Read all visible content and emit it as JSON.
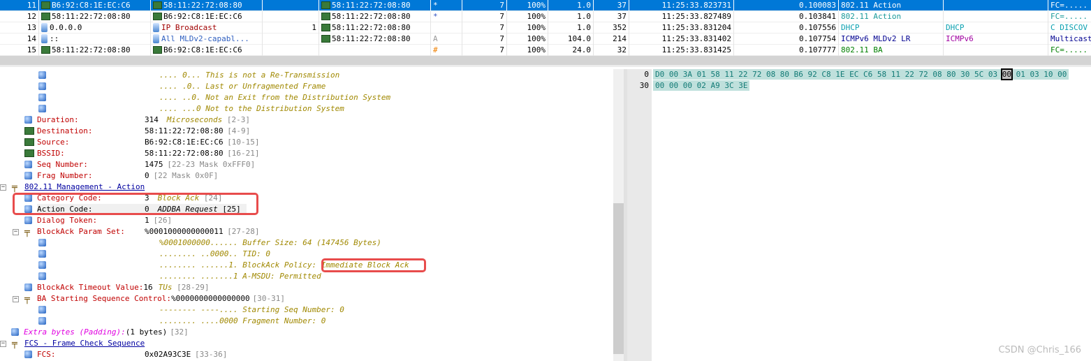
{
  "packets": [
    {
      "no": "11",
      "src": "B6:92:C8:1E:EC:C6",
      "src_icon": "mac",
      "dst": "58:11:22:72:08:80",
      "dst_icon": "mac",
      "col4": "",
      "bssid": "58:11:22:72:08:80",
      "flag": "*",
      "ch": "7",
      "sig": "100%",
      "rate": "1.0",
      "size": "37",
      "time": "11:25:33.823731",
      "delta": "0.100083",
      "proto": "802.11 Action",
      "proto2": "",
      "summary": "FC=.....",
      "color": "#ffffff",
      "selected": true
    },
    {
      "no": "12",
      "src": "58:11:22:72:08:80",
      "src_icon": "mac",
      "dst": "B6:92:C8:1E:EC:C6",
      "dst_icon": "mac",
      "col4": "",
      "bssid": "58:11:22:72:08:80",
      "flag": "*",
      "ch": "7",
      "sig": "100%",
      "rate": "1.0",
      "size": "37",
      "time": "11:25:33.827489",
      "delta": "0.103841",
      "proto": "802.11 Action",
      "proto2": "",
      "summary": "FC=.....",
      "color": "#1a9a9a"
    },
    {
      "no": "13",
      "src": "0.0.0.0",
      "src_icon": "pc",
      "dst": "IP Broadcast",
      "dst_icon": "pc",
      "dst_color": "#a00000",
      "col4": "1",
      "bssid": "58:11:22:72:08:80",
      "flag": "",
      "ch": "7",
      "sig": "100%",
      "rate": "1.0",
      "size": "352",
      "time": "11:25:33.831204",
      "delta": "0.107556",
      "proto": "DHCP",
      "proto2": "DHCP",
      "summary": "C DISCOV",
      "color": "#0aa0b0"
    },
    {
      "no": "14",
      "src": "::",
      "src_icon": "pc",
      "dst": "All MLDv2-capabl...",
      "dst_icon": "pc",
      "dst_color": "#3060c0",
      "col4": "",
      "bssid": "58:11:22:72:08:80",
      "flag": "A",
      "flag_color": "#999",
      "ch": "7",
      "sig": "100%",
      "rate": "104.0",
      "size": "214",
      "time": "11:25:33.831402",
      "delta": "0.107754",
      "proto": "ICMPv6 MLDv2 LR",
      "proto2": "ICMPv6",
      "summary": "Multicast",
      "color": "#000090",
      "proto2_color": "#a000a0"
    },
    {
      "no": "15",
      "src": "58:11:22:72:08:80",
      "src_icon": "mac",
      "dst": "B6:92:C8:1E:EC:C6",
      "dst_icon": "mac",
      "col4": "",
      "bssid": "",
      "flag": "#",
      "flag_color": "#f08000",
      "ch": "7",
      "sig": "100%",
      "rate": "24.0",
      "size": "32",
      "time": "11:25:33.831425",
      "delta": "0.107777",
      "proto": "802.11 BA",
      "proto2": "",
      "summary": "FC=.....",
      "color": "#008000"
    }
  ],
  "tree": [
    {
      "lvl": 2,
      "icon": "cube",
      "bits": ".... 0...",
      "note": "This is not a Re-Transmission"
    },
    {
      "lvl": 2,
      "icon": "cube",
      "bits": ".... .0..",
      "note": "Last or Unfragmented Frame"
    },
    {
      "lvl": 2,
      "icon": "cube",
      "bits": ".... ..0.",
      "note": "Not an Exit from the Distribution System"
    },
    {
      "lvl": 2,
      "icon": "cube",
      "bits": ".... ...0",
      "note": "Not to the Distribution System"
    },
    {
      "lvl": 1,
      "icon": "cube",
      "label": "Duration:",
      "value": "314",
      "note": "Microseconds",
      "range": "[2-3]"
    },
    {
      "lvl": 1,
      "icon": "mac",
      "label": "Destination:",
      "value": "58:11:22:72:08:80",
      "range": "[4-9]"
    },
    {
      "lvl": 1,
      "icon": "mac",
      "label": "Source:",
      "value": "B6:92:C8:1E:EC:C6",
      "range": "[10-15]"
    },
    {
      "lvl": 1,
      "icon": "mac",
      "label": "BSSID:",
      "value": "58:11:22:72:08:80",
      "range": "[16-21]"
    },
    {
      "lvl": 1,
      "icon": "cube",
      "label": "Seq Number:",
      "value": "1475",
      "range": "[22-23 Mask 0xFFF0]"
    },
    {
      "lvl": 1,
      "icon": "cube",
      "label": "Frag Number:",
      "value": "0",
      "range": "[22 Mask 0x0F]"
    },
    {
      "lvl": 0,
      "icon": "tree",
      "header": "802.11 Management - Action"
    },
    {
      "lvl": 1,
      "icon": "cube",
      "label": "Category Code:",
      "value": "3",
      "note": "Block Ack",
      "range": "[24]"
    },
    {
      "lvl": 1,
      "icon": "cube",
      "label": "Action Code:",
      "value": "0",
      "note": "ADDBA Request",
      "range": "[25]",
      "selected": true
    },
    {
      "lvl": 1,
      "icon": "cube",
      "label": "Dialog Token:",
      "value": "1",
      "range": "[26]"
    },
    {
      "lvl": 1,
      "icon": "tree",
      "expand": true,
      "label": "BlockAck Param Set:",
      "value": "%0001000000000011",
      "range": "[27-28]"
    },
    {
      "lvl": 2,
      "icon": "cube",
      "bits": "%0001000000......",
      "note": "Buffer Size: 64 (147456 Bytes)"
    },
    {
      "lvl": 2,
      "icon": "cube",
      "bits": "........ ..0000..",
      "note": "TID: 0"
    },
    {
      "lvl": 2,
      "icon": "cube",
      "bits": "........ ......1.",
      "note": "BlockAck Policy:",
      "note2": "Immediate Block Ack"
    },
    {
      "lvl": 2,
      "icon": "cube",
      "bits": "........ .......1",
      "note": "A-MSDU: Permitted"
    },
    {
      "lvl": 1,
      "icon": "cube",
      "label": "BlockAck Timeout Value:",
      "value": "16",
      "note": "TUs",
      "range": "[28-29]",
      "tight": true
    },
    {
      "lvl": 1,
      "icon": "tree",
      "expand": true,
      "label": "BA Starting Sequence Control:",
      "value": "%0000000000000000",
      "range": "[30-31]",
      "tight": true
    },
    {
      "lvl": 2,
      "icon": "cube",
      "bits": "-------- ----....",
      "note": "Starting Seq Number: 0"
    },
    {
      "lvl": 2,
      "icon": "cube",
      "bits": "........ ....0000",
      "note": "Fragment Number: 0"
    },
    {
      "lvl": 0.5,
      "icon": "cube",
      "pad": "Extra bytes (Padding):",
      "value": "(1 bytes)",
      "range": "[32]"
    },
    {
      "lvl": 0,
      "icon": "tree",
      "header": "FCS - Frame Check Sequence"
    },
    {
      "lvl": 1,
      "icon": "cube",
      "label": "FCS:",
      "value": "0x02A93C3E",
      "range": "[33-36]"
    }
  ],
  "hex": {
    "rows": [
      {
        "offset": "0",
        "pre": "D0 00 3A 01 58 11 22 72 08 80 B6 92 C8 1E EC C6 58 11 22 72 08 80 30 5C 03 ",
        "sel": "00",
        "post": " 01 03 10 00"
      },
      {
        "offset": "30",
        "pre": "00 00 00 02 A9 3C 3E",
        "sel": "",
        "post": ""
      }
    ]
  },
  "watermark": "CSDN @Chris_166",
  "colors": {
    "selection": "#0078d7",
    "label": "#c00000",
    "highlight_box": "#e84c4c"
  }
}
